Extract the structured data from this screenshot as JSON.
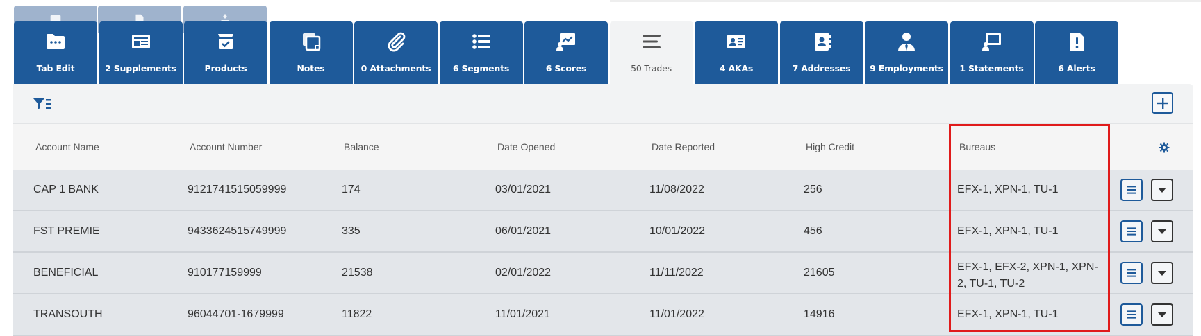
{
  "tabs": [
    {
      "label": "Tab Edit",
      "icon": "folder-icon",
      "active": false
    },
    {
      "label": "2 Supplements",
      "icon": "id-card-icon",
      "active": false
    },
    {
      "label": "Products",
      "icon": "box-icon",
      "active": false
    },
    {
      "label": "Notes",
      "icon": "notes-icon",
      "active": false
    },
    {
      "label": "0 Attachments",
      "icon": "paperclip-icon",
      "active": false
    },
    {
      "label": "6 Segments",
      "icon": "list-icon",
      "active": false
    },
    {
      "label": "6 Scores",
      "icon": "chart-board-icon",
      "active": false
    },
    {
      "label": "50 Trades",
      "icon": "menu-lines-icon",
      "active": true
    },
    {
      "label": "4 AKAs",
      "icon": "contact-card-icon",
      "active": false
    },
    {
      "label": "7 Addresses",
      "icon": "address-book-icon",
      "active": false
    },
    {
      "label": "9 Employments",
      "icon": "user-tie-icon",
      "active": false
    },
    {
      "label": "1 Statements",
      "icon": "presentation-icon",
      "active": false
    },
    {
      "label": "6 Alerts",
      "icon": "file-alert-icon",
      "active": false
    }
  ],
  "table": {
    "columns": [
      {
        "key": "account_name",
        "label": "Account Name"
      },
      {
        "key": "account_number",
        "label": "Account Number"
      },
      {
        "key": "balance",
        "label": "Balance"
      },
      {
        "key": "date_opened",
        "label": "Date Opened"
      },
      {
        "key": "date_reported",
        "label": "Date Reported"
      },
      {
        "key": "high_credit",
        "label": "High Credit"
      },
      {
        "key": "bureaus",
        "label": "Bureaus"
      }
    ],
    "rows": [
      {
        "account_name": "CAP 1 BANK",
        "account_number": "9121741515059999",
        "balance": "174",
        "date_opened": "03/01/2021",
        "date_reported": "11/08/2022",
        "high_credit": "256",
        "bureaus": "EFX-1, XPN-1, TU-1"
      },
      {
        "account_name": "FST PREMIE",
        "account_number": "9433624515749999",
        "balance": "335",
        "date_opened": "06/01/2021",
        "date_reported": "10/01/2022",
        "high_credit": "456",
        "bureaus": "EFX-1, XPN-1, TU-1"
      },
      {
        "account_name": "BENEFICIAL",
        "account_number": "910177159999",
        "balance": "21538",
        "date_opened": "02/01/2022",
        "date_reported": "11/11/2022",
        "high_credit": "21605",
        "bureaus": "EFX-1, EFX-2, XPN-1, XPN-2, TU-1, TU-2"
      },
      {
        "account_name": "TRANSOUTH",
        "account_number": "96044701-1679999",
        "balance": "11822",
        "date_opened": "11/01/2021",
        "date_reported": "11/01/2022",
        "high_credit": "14916",
        "bureaus": "EFX-1, XPN-1, TU-1"
      }
    ]
  },
  "colors": {
    "tab_blue": "#1e5a9a",
    "panel_bg": "#f2f3f4",
    "row_bg": "#e3e6ea",
    "highlight_red": "#e01b1b"
  }
}
